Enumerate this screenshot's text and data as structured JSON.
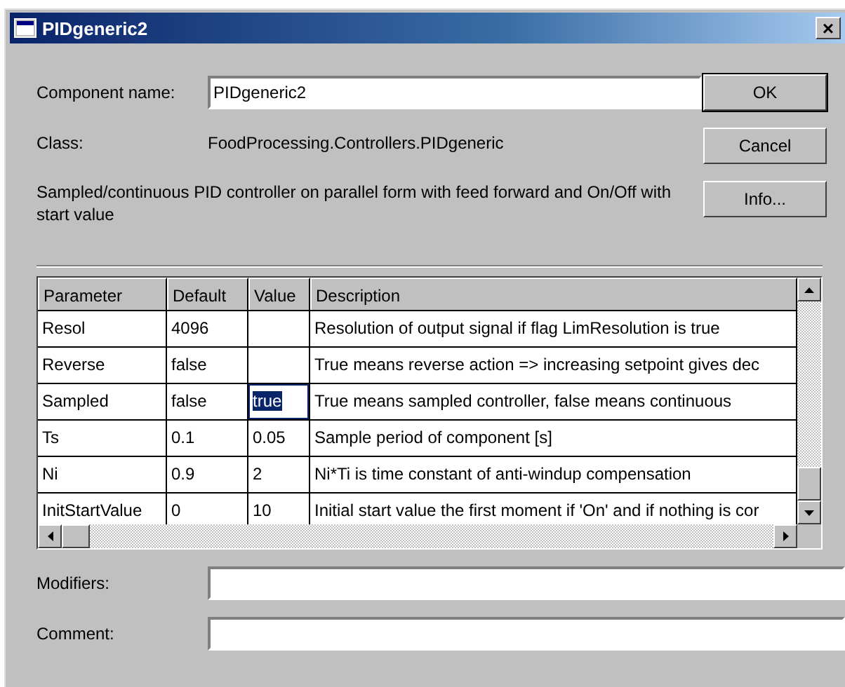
{
  "window": {
    "title": "PIDgeneric2",
    "close": "×"
  },
  "component_name": {
    "label": "Component name:",
    "value": "PIDgeneric2"
  },
  "class": {
    "label": "Class:",
    "value": "FoodProcessing.Controllers.PIDgeneric"
  },
  "description": "Sampled/continuous PID controller on parallel form with feed forward and On/Off with start value",
  "buttons": [
    "OK",
    "Cancel",
    "Info..."
  ],
  "table": {
    "columns": [
      "Parameter",
      "Default",
      "Value",
      "Description"
    ],
    "rows": [
      {
        "cells": [
          "Resol",
          "4096",
          "",
          "Resolution of output signal if flag LimResolution is true"
        ],
        "selected": false
      },
      {
        "cells": [
          "Reverse",
          "false",
          "",
          "True means reverse action => increasing setpoint gives dec"
        ],
        "selected": false
      },
      {
        "cells": [
          "Sampled",
          "false",
          "true",
          "True means sampled controller, false means continuous"
        ],
        "selected": true
      },
      {
        "cells": [
          "Ts",
          "0.1",
          "0.05",
          "Sample period of component [s]"
        ],
        "selected": false
      },
      {
        "cells": [
          "Ni",
          "0.9",
          "2",
          "Ni*Ti is time constant of anti-windup compensation"
        ],
        "selected": false
      },
      {
        "cells": [
          "InitStartValue",
          "0",
          "10",
          "Initial start value the first moment if 'On' and if nothing is cor"
        ],
        "selected": false
      }
    ]
  },
  "fields": [
    {
      "label": "Modifiers:"
    },
    {
      "label": "Comment:"
    }
  ]
}
